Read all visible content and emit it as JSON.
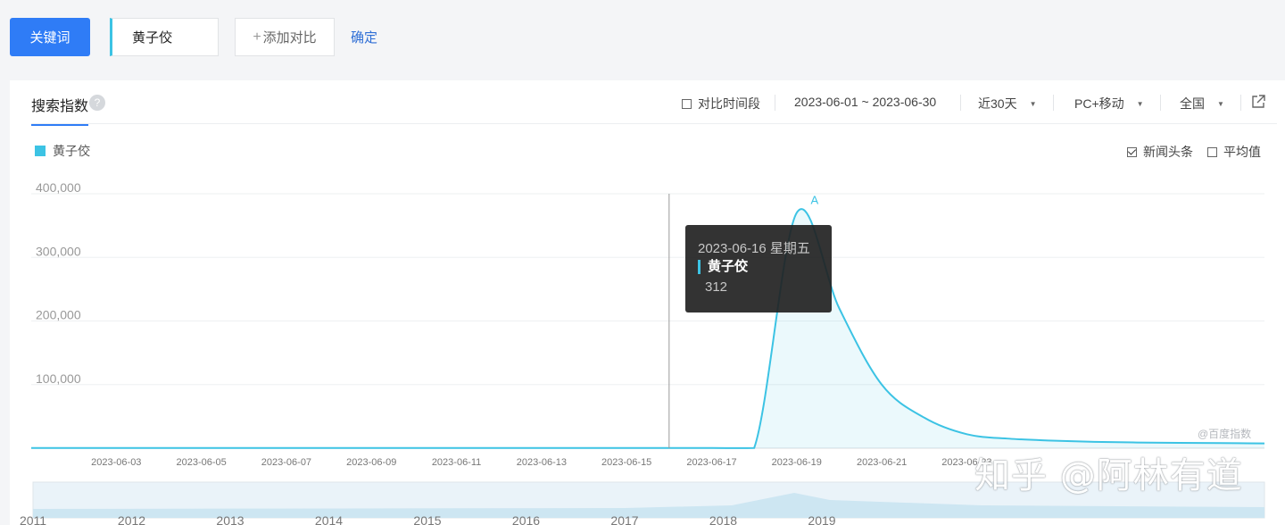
{
  "toolbar": {
    "keyword_button": "关键词",
    "keyword_value": "黄子佼",
    "add_compare": "添加对比",
    "add_compare_plus": "+",
    "confirm": "确定"
  },
  "panel": {
    "tab_title": "搜索指数",
    "help_icon": "?",
    "compare_period": "对比时间段",
    "date_range": "2023-06-01 ~ 2023-06-30",
    "period_select": "近30天",
    "device_select": "PC+移动",
    "region_select": "全国",
    "news_headlines": "新闻头条",
    "news_headlines_checked": true,
    "average": "平均值",
    "average_checked": false
  },
  "tooltip": {
    "date": "2023-06-16 星期五",
    "series_name": "黄子佼",
    "value": "312"
  },
  "source_label": "@百度指数",
  "watermark": "知乎 @阿林有道",
  "colors": {
    "accent": "#2f7cf6",
    "series": "#3cc3e4"
  },
  "chart_data": {
    "type": "area",
    "title": "",
    "series": [
      {
        "name": "黄子佼",
        "color": "#3cc3e4",
        "x": [
          "2023-06-01",
          "2023-06-02",
          "2023-06-03",
          "2023-06-04",
          "2023-06-05",
          "2023-06-06",
          "2023-06-07",
          "2023-06-08",
          "2023-06-09",
          "2023-06-10",
          "2023-06-11",
          "2023-06-12",
          "2023-06-13",
          "2023-06-14",
          "2023-06-15",
          "2023-06-16",
          "2023-06-17",
          "2023-06-18",
          "2023-06-19",
          "2023-06-20",
          "2023-06-21",
          "2023-06-22",
          "2023-06-23",
          "2023-06-24",
          "2023-06-25",
          "2023-06-26",
          "2023-06-27",
          "2023-06-28",
          "2023-06-29",
          "2023-06-30"
        ],
        "values": [
          300,
          300,
          300,
          310,
          300,
          300,
          300,
          310,
          300,
          300,
          300,
          300,
          300,
          300,
          310,
          312,
          300,
          320,
          370000,
          220000,
          100000,
          48000,
          22000,
          15000,
          12000,
          10000,
          9000,
          8500,
          8000,
          7500
        ]
      }
    ],
    "x_tick_labels": [
      "2023-06-03",
      "2023-06-05",
      "2023-06-07",
      "2023-06-09",
      "2023-06-11",
      "2023-06-13",
      "2023-06-15",
      "2023-06-17",
      "2023-06-19",
      "2023-06-21",
      "2023-06-23"
    ],
    "y_tick_labels": [
      "400,000",
      "300,000",
      "200,000",
      "100,000"
    ],
    "ylim": [
      0,
      400000
    ],
    "annotations": [
      {
        "label": "A",
        "x": "2023-06-19"
      }
    ],
    "navigator_years": [
      "2011",
      "2012",
      "2013",
      "2014",
      "2015",
      "2016",
      "2017",
      "2018",
      "2019"
    ],
    "grid": true
  }
}
